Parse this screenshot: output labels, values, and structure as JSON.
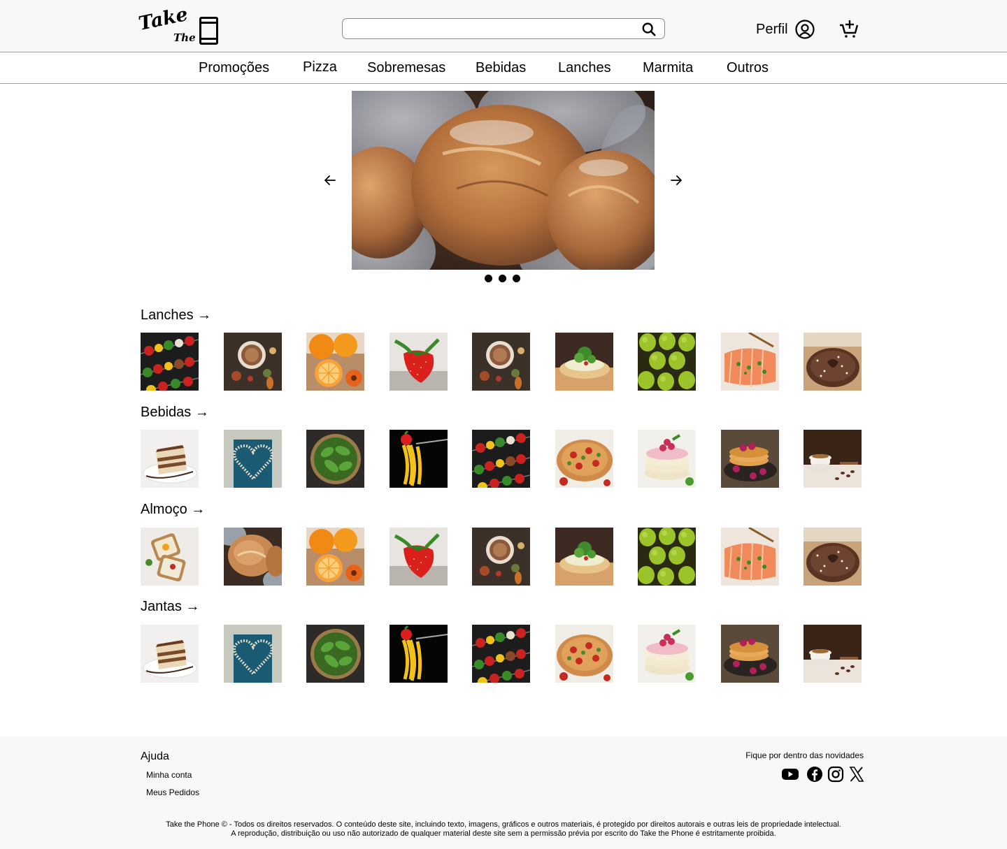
{
  "header": {
    "logo_text_1": "Take",
    "logo_text_2": "The",
    "search_placeholder": "",
    "profile_label": "Perfil"
  },
  "nav": {
    "items": [
      "Promoções",
      "Pizza",
      "Sobremesas",
      "Bebidas",
      "Lanches",
      "Marmita",
      "Outros"
    ]
  },
  "carousel": {
    "prev_label": "←",
    "next_label": "→",
    "slides": 3,
    "current": 1
  },
  "sections": [
    {
      "title": "Lanches →",
      "items": [
        "skewers",
        "coffee-spices",
        "oranges",
        "strawberry",
        "coffee-spices",
        "bruschetta",
        "pears",
        "salmon",
        "chocolate-cake"
      ]
    },
    {
      "title": "Bebidas →",
      "items": [
        "tiramisu",
        "heart-flour",
        "spinach",
        "pasta-fork",
        "skewers",
        "pizza",
        "pancakes-raspberry",
        "pancakes-dark",
        "coffee-cup"
      ]
    },
    {
      "title": "Almoço →",
      "items": [
        "toast",
        "bread",
        "oranges",
        "strawberry",
        "coffee-spices",
        "bruschetta",
        "pears",
        "salmon",
        "chocolate-cake"
      ]
    },
    {
      "title": "Jantas →",
      "items": [
        "tiramisu",
        "heart-flour",
        "spinach",
        "pasta-fork",
        "skewers",
        "pizza",
        "pancakes-raspberry",
        "pancakes-dark",
        "coffee-cup"
      ]
    }
  ],
  "footer": {
    "help_title": "Ajuda",
    "links": [
      "Minha conta",
      "Meus Pedidos"
    ],
    "newsletter": "Fique por dentro das novidades",
    "social": [
      "youtube-icon",
      "facebook-icon",
      "instagram-icon",
      "x-icon"
    ],
    "copyright_line1": "Take the Phone © - Todos os direitos reservados. O conteúdo deste site, incluindo texto, imagens, gráficos e outros materiais, é protegido por direitos autorais e outras leis de propriedade intelectual.",
    "copyright_line2": "A reprodução, distribuição ou uso não autorizado de qualquer material deste site sem a permissão prévia por escrito do Take the Phone é estritamente proibida."
  }
}
